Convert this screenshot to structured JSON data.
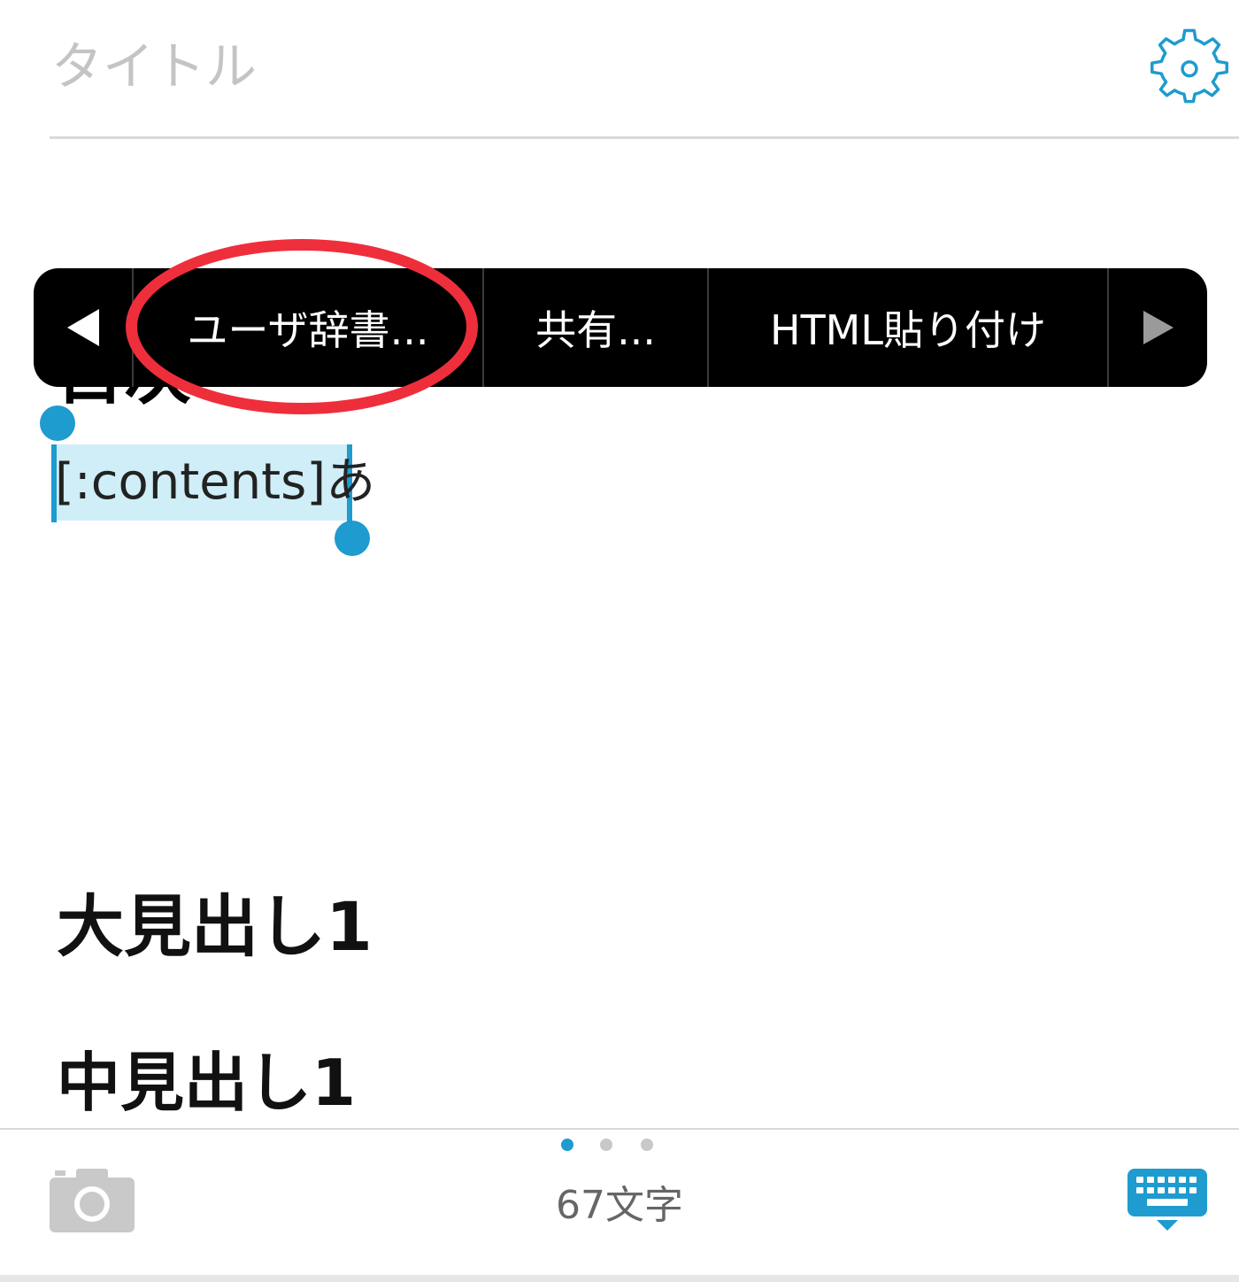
{
  "header": {
    "title_placeholder": "タイトル",
    "settings_icon": "gear-icon"
  },
  "context_menu": {
    "prev_icon": "triangle-left-icon",
    "items": [
      {
        "label": "ユーザ辞書..."
      },
      {
        "label": "共有..."
      },
      {
        "label": "HTML貼り付け"
      }
    ],
    "next_icon": "triangle-right-icon"
  },
  "editor": {
    "partial_heading": "目次",
    "selected_text": "[:contents]あ",
    "heading_large": "大見出し1",
    "heading_medium": "中見出し1"
  },
  "footer": {
    "camera_icon": "camera-icon",
    "char_count": "67文字",
    "keyboard_icon": "keyboard-icon",
    "pager": {
      "total": 3,
      "active_index": 0
    }
  },
  "colors": {
    "accent": "#1e9bcf",
    "selection": "#cfeef7",
    "annotation": "#ef2e3c",
    "menu_background": "#000000",
    "placeholder": "#c4c4c4"
  }
}
